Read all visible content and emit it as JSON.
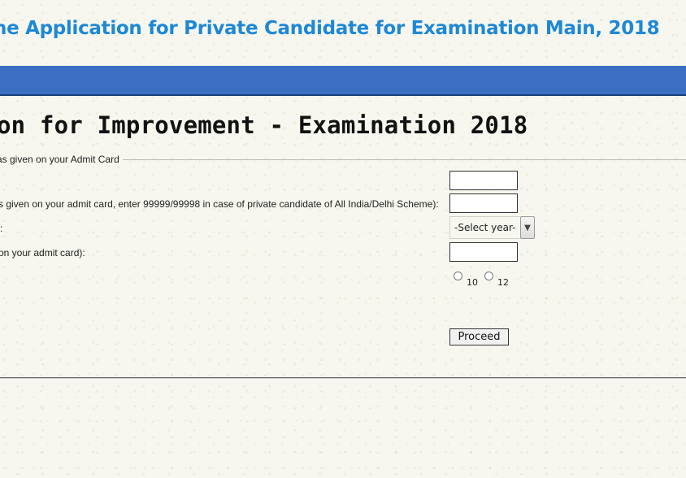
{
  "header": {
    "title": "ne Application for Private Candidate for Examination Main, 2018"
  },
  "page": {
    "title": "on for Improvement - Examination 2018"
  },
  "form": {
    "legend": "as given on your Admit Card",
    "fields": [
      {
        "label": "",
        "value": ""
      },
      {
        "label": "s given on your admit card, enter 99999/99998 in case of private candidate of All India/Delhi Scheme):",
        "value": ""
      },
      {
        "label": ":",
        "selected": "-Select year-"
      },
      {
        "label": " on your admit card):",
        "value": ""
      }
    ],
    "class_options": [
      "10",
      "12"
    ],
    "proceed_label": "Proceed"
  },
  "colors": {
    "header_text": "#1e88d6",
    "nav_bar": "#3a6fc4"
  }
}
